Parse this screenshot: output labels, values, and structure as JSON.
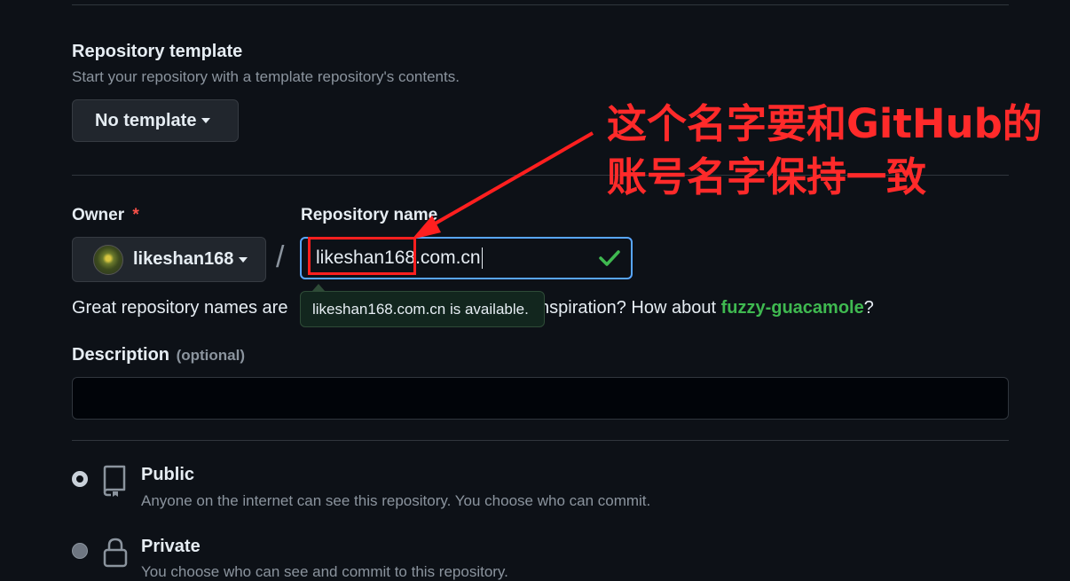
{
  "template": {
    "title": "Repository template",
    "subtitle": "Start your repository with a template repository's contents.",
    "button_label": "No template"
  },
  "owner": {
    "label": "Owner",
    "required_mark": "*",
    "value": "likeshan168"
  },
  "separator": "/",
  "repo": {
    "label": "Repository name",
    "value_highlight": "likeshan168",
    "value_rest": ".com.cn",
    "tooltip": "likeshan168.com.cn is available."
  },
  "hint": {
    "prefix": "Great repository names are",
    "suffix": "nspiration? How about",
    "suggestion": "fuzzy-guacamole",
    "end": "?"
  },
  "description": {
    "label": "Description",
    "optional": "(optional)",
    "value": ""
  },
  "visibility": {
    "public": {
      "title": "Public",
      "desc": "Anyone on the internet can see this repository. You choose who can commit.",
      "selected": true
    },
    "private": {
      "title": "Private",
      "desc": "You choose who can see and commit to this repository.",
      "selected": false
    }
  },
  "annotation": {
    "line1": "这个名字要和GitHub的",
    "line2": "账号名字保持一致",
    "color": "#ff2a2a"
  },
  "colors": {
    "accent_blue": "#58a6ff",
    "success_green": "#3fb950",
    "bg": "#0d1117"
  },
  "icons": {
    "check": "check-icon",
    "repo": "repo-book-icon",
    "lock": "lock-icon",
    "avatar": "avatar"
  }
}
